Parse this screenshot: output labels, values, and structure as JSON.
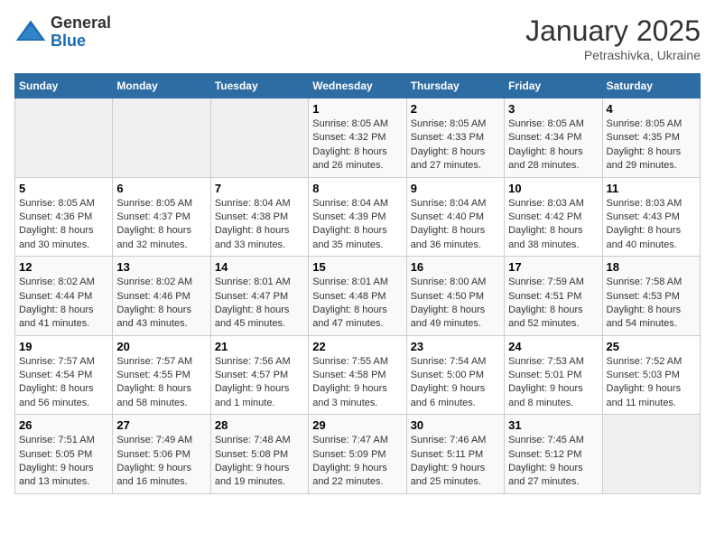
{
  "header": {
    "logo_general": "General",
    "logo_blue": "Blue",
    "month_title": "January 2025",
    "location": "Petrashivka, Ukraine"
  },
  "weekdays": [
    "Sunday",
    "Monday",
    "Tuesday",
    "Wednesday",
    "Thursday",
    "Friday",
    "Saturday"
  ],
  "weeks": [
    [
      {
        "day": "",
        "info": ""
      },
      {
        "day": "",
        "info": ""
      },
      {
        "day": "",
        "info": ""
      },
      {
        "day": "1",
        "info": "Sunrise: 8:05 AM\nSunset: 4:32 PM\nDaylight: 8 hours and 26 minutes."
      },
      {
        "day": "2",
        "info": "Sunrise: 8:05 AM\nSunset: 4:33 PM\nDaylight: 8 hours and 27 minutes."
      },
      {
        "day": "3",
        "info": "Sunrise: 8:05 AM\nSunset: 4:34 PM\nDaylight: 8 hours and 28 minutes."
      },
      {
        "day": "4",
        "info": "Sunrise: 8:05 AM\nSunset: 4:35 PM\nDaylight: 8 hours and 29 minutes."
      }
    ],
    [
      {
        "day": "5",
        "info": "Sunrise: 8:05 AM\nSunset: 4:36 PM\nDaylight: 8 hours and 30 minutes."
      },
      {
        "day": "6",
        "info": "Sunrise: 8:05 AM\nSunset: 4:37 PM\nDaylight: 8 hours and 32 minutes."
      },
      {
        "day": "7",
        "info": "Sunrise: 8:04 AM\nSunset: 4:38 PM\nDaylight: 8 hours and 33 minutes."
      },
      {
        "day": "8",
        "info": "Sunrise: 8:04 AM\nSunset: 4:39 PM\nDaylight: 8 hours and 35 minutes."
      },
      {
        "day": "9",
        "info": "Sunrise: 8:04 AM\nSunset: 4:40 PM\nDaylight: 8 hours and 36 minutes."
      },
      {
        "day": "10",
        "info": "Sunrise: 8:03 AM\nSunset: 4:42 PM\nDaylight: 8 hours and 38 minutes."
      },
      {
        "day": "11",
        "info": "Sunrise: 8:03 AM\nSunset: 4:43 PM\nDaylight: 8 hours and 40 minutes."
      }
    ],
    [
      {
        "day": "12",
        "info": "Sunrise: 8:02 AM\nSunset: 4:44 PM\nDaylight: 8 hours and 41 minutes."
      },
      {
        "day": "13",
        "info": "Sunrise: 8:02 AM\nSunset: 4:46 PM\nDaylight: 8 hours and 43 minutes."
      },
      {
        "day": "14",
        "info": "Sunrise: 8:01 AM\nSunset: 4:47 PM\nDaylight: 8 hours and 45 minutes."
      },
      {
        "day": "15",
        "info": "Sunrise: 8:01 AM\nSunset: 4:48 PM\nDaylight: 8 hours and 47 minutes."
      },
      {
        "day": "16",
        "info": "Sunrise: 8:00 AM\nSunset: 4:50 PM\nDaylight: 8 hours and 49 minutes."
      },
      {
        "day": "17",
        "info": "Sunrise: 7:59 AM\nSunset: 4:51 PM\nDaylight: 8 hours and 52 minutes."
      },
      {
        "day": "18",
        "info": "Sunrise: 7:58 AM\nSunset: 4:53 PM\nDaylight: 8 hours and 54 minutes."
      }
    ],
    [
      {
        "day": "19",
        "info": "Sunrise: 7:57 AM\nSunset: 4:54 PM\nDaylight: 8 hours and 56 minutes."
      },
      {
        "day": "20",
        "info": "Sunrise: 7:57 AM\nSunset: 4:55 PM\nDaylight: 8 hours and 58 minutes."
      },
      {
        "day": "21",
        "info": "Sunrise: 7:56 AM\nSunset: 4:57 PM\nDaylight: 9 hours and 1 minute."
      },
      {
        "day": "22",
        "info": "Sunrise: 7:55 AM\nSunset: 4:58 PM\nDaylight: 9 hours and 3 minutes."
      },
      {
        "day": "23",
        "info": "Sunrise: 7:54 AM\nSunset: 5:00 PM\nDaylight: 9 hours and 6 minutes."
      },
      {
        "day": "24",
        "info": "Sunrise: 7:53 AM\nSunset: 5:01 PM\nDaylight: 9 hours and 8 minutes."
      },
      {
        "day": "25",
        "info": "Sunrise: 7:52 AM\nSunset: 5:03 PM\nDaylight: 9 hours and 11 minutes."
      }
    ],
    [
      {
        "day": "26",
        "info": "Sunrise: 7:51 AM\nSunset: 5:05 PM\nDaylight: 9 hours and 13 minutes."
      },
      {
        "day": "27",
        "info": "Sunrise: 7:49 AM\nSunset: 5:06 PM\nDaylight: 9 hours and 16 minutes."
      },
      {
        "day": "28",
        "info": "Sunrise: 7:48 AM\nSunset: 5:08 PM\nDaylight: 9 hours and 19 minutes."
      },
      {
        "day": "29",
        "info": "Sunrise: 7:47 AM\nSunset: 5:09 PM\nDaylight: 9 hours and 22 minutes."
      },
      {
        "day": "30",
        "info": "Sunrise: 7:46 AM\nSunset: 5:11 PM\nDaylight: 9 hours and 25 minutes."
      },
      {
        "day": "31",
        "info": "Sunrise: 7:45 AM\nSunset: 5:12 PM\nDaylight: 9 hours and 27 minutes."
      },
      {
        "day": "",
        "info": ""
      }
    ]
  ]
}
